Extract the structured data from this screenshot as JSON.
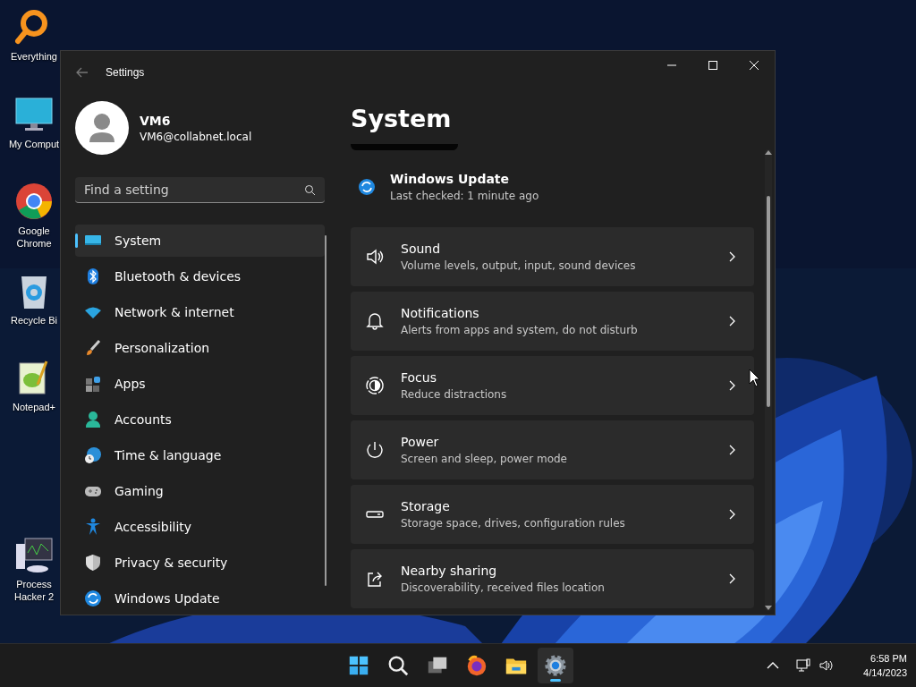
{
  "desktop": {
    "icons": [
      {
        "label": "Everything"
      },
      {
        "label": "My Comput"
      },
      {
        "label": "Google Chrome"
      },
      {
        "label": "Recycle Bi"
      },
      {
        "label": "Notepad+"
      },
      {
        "label": "Process Hacker 2"
      }
    ]
  },
  "window": {
    "title": "Settings",
    "profile": {
      "name": "VM6",
      "email": "VM6@collabnet.local"
    },
    "search": {
      "placeholder": "Find a setting"
    },
    "sidebar": {
      "items": [
        {
          "label": "System",
          "selected": true
        },
        {
          "label": "Bluetooth & devices",
          "selected": false
        },
        {
          "label": "Network & internet",
          "selected": false
        },
        {
          "label": "Personalization",
          "selected": false
        },
        {
          "label": "Apps",
          "selected": false
        },
        {
          "label": "Accounts",
          "selected": false
        },
        {
          "label": "Time & language",
          "selected": false
        },
        {
          "label": "Gaming",
          "selected": false
        },
        {
          "label": "Accessibility",
          "selected": false
        },
        {
          "label": "Privacy & security",
          "selected": false
        },
        {
          "label": "Windows Update",
          "selected": false
        }
      ]
    },
    "page_title": "System",
    "update": {
      "title": "Windows Update",
      "subtitle": "Last checked: 1 minute ago"
    },
    "cards": [
      {
        "title": "Sound",
        "subtitle": "Volume levels, output, input, sound devices"
      },
      {
        "title": "Notifications",
        "subtitle": "Alerts from apps and system, do not disturb"
      },
      {
        "title": "Focus",
        "subtitle": "Reduce distractions"
      },
      {
        "title": "Power",
        "subtitle": "Screen and sleep, power mode"
      },
      {
        "title": "Storage",
        "subtitle": "Storage space, drives, configuration rules"
      },
      {
        "title": "Nearby sharing",
        "subtitle": "Discoverability, received files location"
      }
    ]
  },
  "taskbar": {
    "apps": [
      {
        "selected": false
      },
      {
        "selected": false
      },
      {
        "selected": false
      },
      {
        "selected": false
      },
      {
        "selected": false
      },
      {
        "selected": true
      }
    ],
    "clock": {
      "time": "6:58 PM",
      "date": "4/14/2023"
    }
  }
}
